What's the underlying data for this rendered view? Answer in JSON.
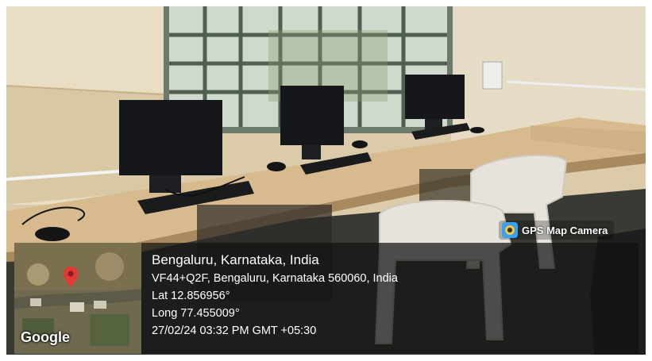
{
  "badge": {
    "label": "GPS Map Camera",
    "icon": "camera-pin-icon"
  },
  "map": {
    "logo": "Google",
    "pin_icon": "map-pin-icon"
  },
  "location": {
    "place": "Bengaluru, Karnataka, India",
    "address": "VF44+Q2F, Bengaluru, Karnataka 560060, India",
    "lat": "Lat 12.856956°",
    "long": "Long 77.455009°",
    "timestamp": "27/02/24 03:32 PM GMT +05:30"
  },
  "colors": {
    "overlay": "#121212",
    "pin": "#e53935"
  }
}
